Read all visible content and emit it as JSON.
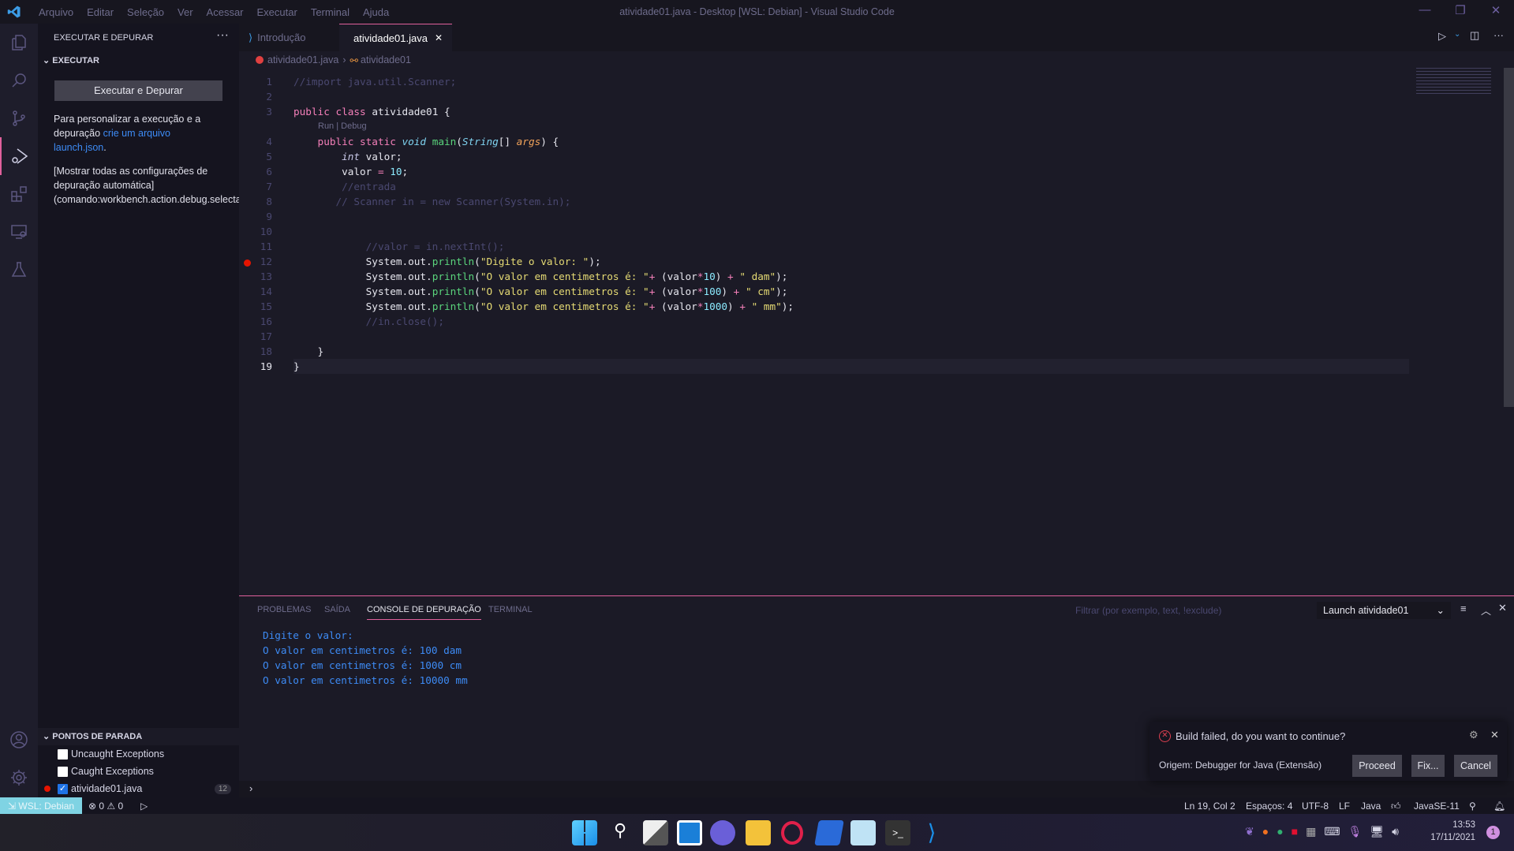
{
  "titlebar": {
    "menus": [
      "Arquivo",
      "Editar",
      "Seleção",
      "Ver",
      "Acessar",
      "Executar",
      "Terminal",
      "Ajuda"
    ],
    "title": "atividade01.java - Desktop [WSL: Debian] - Visual Studio Code"
  },
  "sidebar": {
    "title": "EXECUTAR E DEPURAR",
    "more": "···",
    "section": "EXECUTAR",
    "run_button": "Executar e Depurar",
    "p1a": "Para personalizar a execução e a",
    "p1b": "depuração ",
    "p1link1": "crie um arquivo",
    "p1link2": "launch.json",
    "p1end": ".",
    "p2a": "[Mostrar todas as configurações de",
    "p2b": "depuração automática]",
    "p2c": "(comando:workbench.action.debug.selectandstart)",
    "breakpoints": {
      "title": "PONTOS DE PARADA",
      "items": [
        {
          "label": "Uncaught Exceptions",
          "checked": false
        },
        {
          "label": "Caught Exceptions",
          "checked": false
        },
        {
          "label": "atividade01.java",
          "checked": true,
          "badge": "12"
        }
      ]
    }
  },
  "tabs": [
    {
      "label": "Introdução",
      "active": false
    },
    {
      "label": "atividade01.java",
      "active": true,
      "close": "✕"
    }
  ],
  "breadcrumb": [
    "atividade01.java",
    "atividade01"
  ],
  "codelens": "Run | Debug",
  "code": [
    [
      [
        "//import java.util.Scanner;",
        "c"
      ]
    ],
    [],
    [
      [
        "public class ",
        "k"
      ],
      [
        "atividade01 ",
        "p"
      ],
      [
        "{",
        "p"
      ]
    ],
    [
      [
        "    public static ",
        "k"
      ],
      [
        "void ",
        "t"
      ],
      [
        "main",
        "f"
      ],
      [
        "(",
        "p"
      ],
      [
        "String",
        "t"
      ],
      [
        "[] ",
        "p"
      ],
      [
        "args",
        "a"
      ],
      [
        ") {",
        "p"
      ]
    ],
    [
      [
        "        ",
        "p"
      ],
      [
        "int ",
        "i"
      ],
      [
        "valor;",
        "p"
      ]
    ],
    [
      [
        "        valor ",
        "p"
      ],
      [
        "= ",
        "k"
      ],
      [
        "10",
        "n"
      ],
      [
        ";",
        "p"
      ]
    ],
    [
      [
        "        //entrada",
        "c"
      ]
    ],
    [
      [
        "       // Scanner in = new Scanner(System.in);",
        "c"
      ]
    ],
    [],
    [],
    [
      [
        "            //valor = in.nextInt();",
        "c"
      ]
    ],
    [
      [
        "            System.out.",
        "p"
      ],
      [
        "println",
        "f"
      ],
      [
        "(",
        "p"
      ],
      [
        "\"Digite o valor: \"",
        "s"
      ],
      [
        ");",
        "p"
      ]
    ],
    [
      [
        "            System.out.",
        "p"
      ],
      [
        "println",
        "f"
      ],
      [
        "(",
        "p"
      ],
      [
        "\"O valor em centimetros é: \"",
        "s"
      ],
      [
        "+ ",
        "k"
      ],
      [
        "(valor",
        "p"
      ],
      [
        "*",
        "k"
      ],
      [
        "10",
        "n"
      ],
      [
        ") ",
        "p"
      ],
      [
        "+ ",
        "k"
      ],
      [
        "\" dam\"",
        "s"
      ],
      [
        ");",
        "p"
      ]
    ],
    [
      [
        "            System.out.",
        "p"
      ],
      [
        "println",
        "f"
      ],
      [
        "(",
        "p"
      ],
      [
        "\"O valor em centimetros é: \"",
        "s"
      ],
      [
        "+ ",
        "k"
      ],
      [
        "(valor",
        "p"
      ],
      [
        "*",
        "k"
      ],
      [
        "100",
        "n"
      ],
      [
        ") ",
        "p"
      ],
      [
        "+ ",
        "k"
      ],
      [
        "\" cm\"",
        "s"
      ],
      [
        ");",
        "p"
      ]
    ],
    [
      [
        "            System.out.",
        "p"
      ],
      [
        "println",
        "f"
      ],
      [
        "(",
        "p"
      ],
      [
        "\"O valor em centimetros é: \"",
        "s"
      ],
      [
        "+ ",
        "k"
      ],
      [
        "(valor",
        "p"
      ],
      [
        "*",
        "k"
      ],
      [
        "1000",
        "n"
      ],
      [
        ") ",
        "p"
      ],
      [
        "+ ",
        "k"
      ],
      [
        "\" mm\"",
        "s"
      ],
      [
        ");",
        "p"
      ]
    ],
    [
      [
        "            //in.close();",
        "c"
      ]
    ],
    [],
    [
      [
        "    }",
        "p"
      ]
    ],
    [
      [
        "}",
        "p"
      ]
    ]
  ],
  "breakpoint_line": 12,
  "current_line": 19,
  "panel": {
    "tabs": [
      "PROBLEMAS",
      "SAÍDA",
      "CONSOLE DE DEPURAÇÃO",
      "TERMINAL"
    ],
    "active_tab": 2,
    "filter_placeholder": "Filtrar (por exemplo, text, !exclude)",
    "launch": "Launch atividade01",
    "output": [
      "Digite o valor:",
      "O valor em centimetros é: 100 dam",
      "O valor em centimetros é: 1000 cm",
      "O valor em centimetros é: 10000 mm"
    ]
  },
  "notification": {
    "message": "Build failed, do you want to continue?",
    "source": "Origem: Debugger for Java (Extensão)",
    "buttons": [
      "Proceed",
      "Fix...",
      "Cancel"
    ]
  },
  "status": {
    "remote": "WSL: Debian",
    "errors": "0",
    "warnings": "0",
    "position": "Ln 19, Col 2",
    "spaces": "Espaços: 4",
    "encoding": "UTF-8",
    "eol": "LF",
    "language": "Java",
    "runtime": "JavaSE-11"
  },
  "taskbar": {
    "time": "13:53",
    "date": "17/11/2021",
    "notifications": "1"
  },
  "colors": {
    "accent": "#e0609c",
    "remote": "#7fd3e3",
    "link": "#3d8bf5"
  }
}
